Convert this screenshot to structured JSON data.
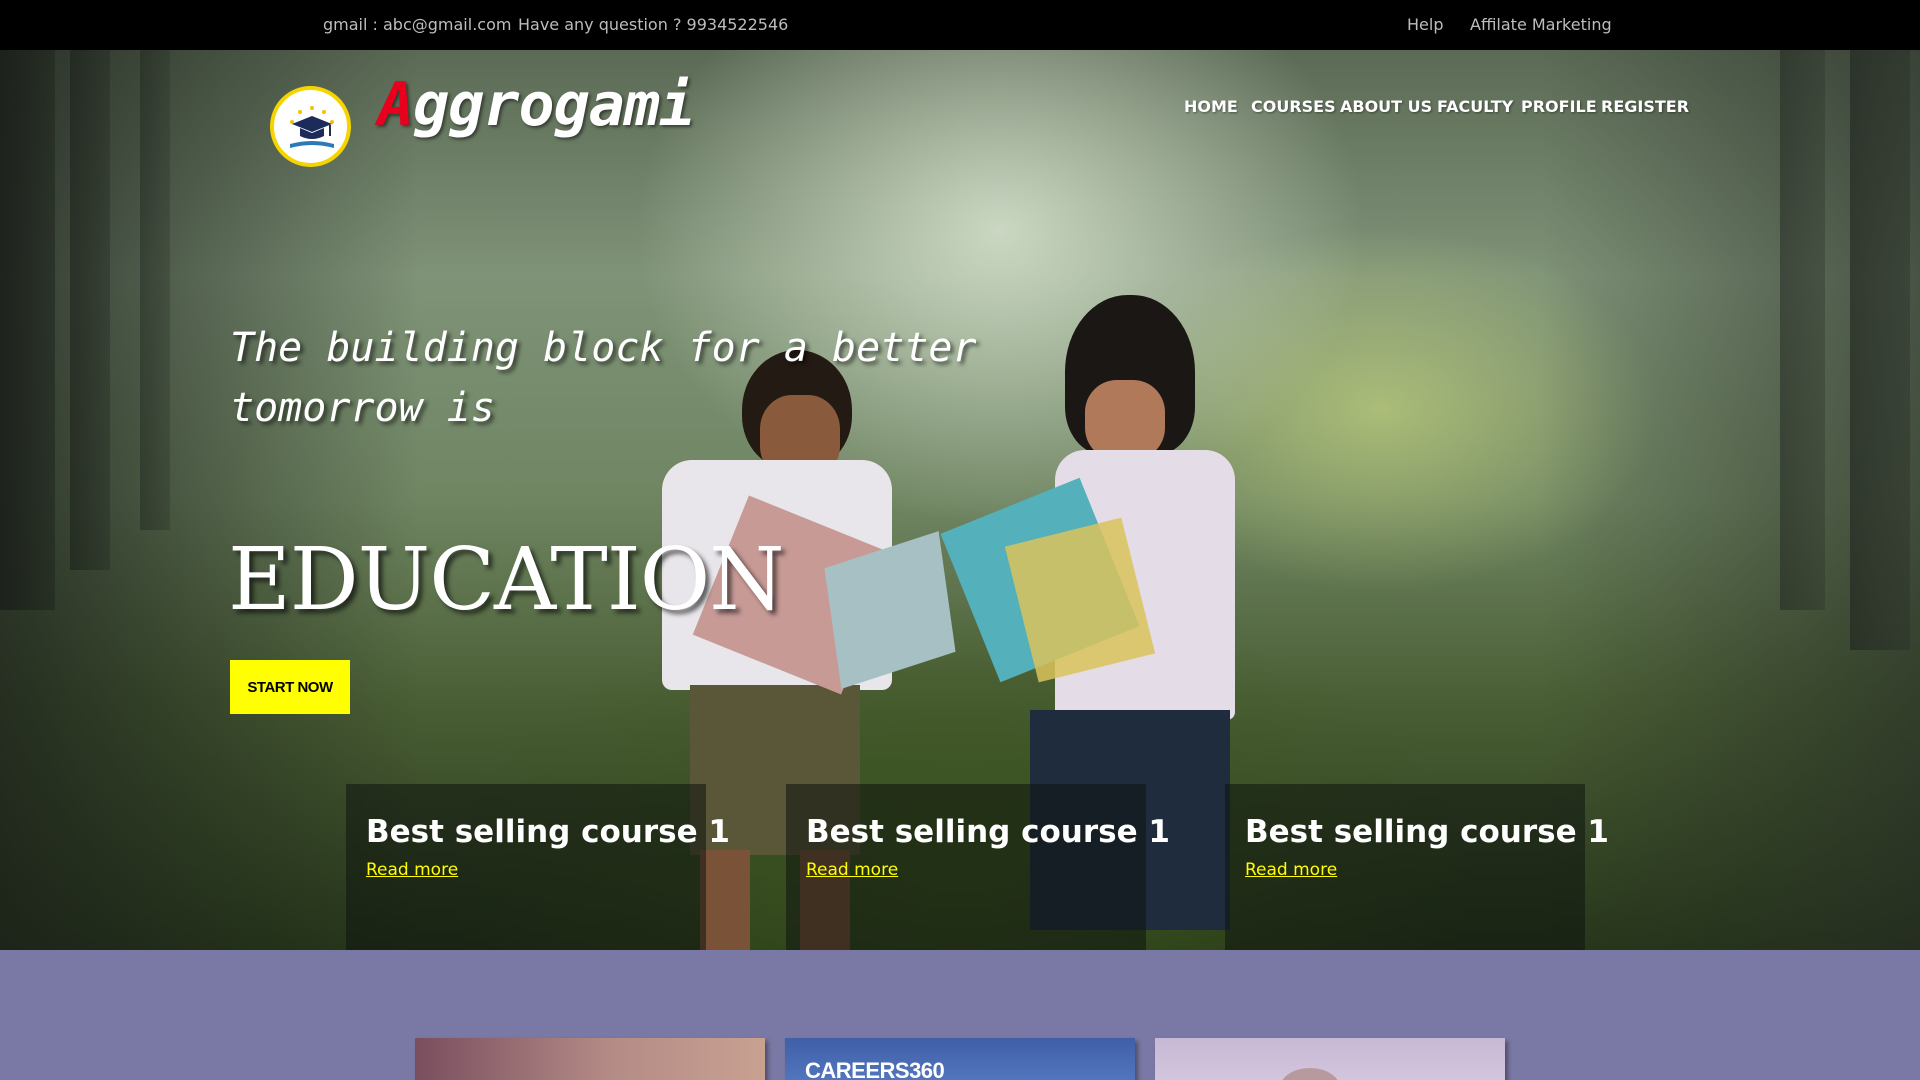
{
  "topbar": {
    "email": "gmail : abc@gmail.com",
    "question": "Have any question ? 9934522546",
    "help": "Help",
    "affiliate": "Affilate Marketing"
  },
  "brand": {
    "first_letter": "A",
    "rest": "ggrogami"
  },
  "nav": [
    "HOME",
    "COURSES",
    "ABOUT US",
    "FACULTY",
    "PROFILE",
    "REGISTER"
  ],
  "hero": {
    "tagline_line1": "The building block for a better",
    "tagline_line2": "tomorrow is",
    "headline": "EDUCATION",
    "cta": "START NOW"
  },
  "cards": [
    {
      "title": "Best selling course 1",
      "link": "Read more"
    },
    {
      "title": "Best selling course 1",
      "link": "Read more"
    },
    {
      "title": "Best selling course 1",
      "link": "Read more"
    }
  ],
  "thumbnails": {
    "careers_logo": "CAREERS360"
  },
  "colors": {
    "accent_yellow": "#ffff00",
    "brand_red": "#e8001c",
    "section_bg": "#7a78a4"
  }
}
